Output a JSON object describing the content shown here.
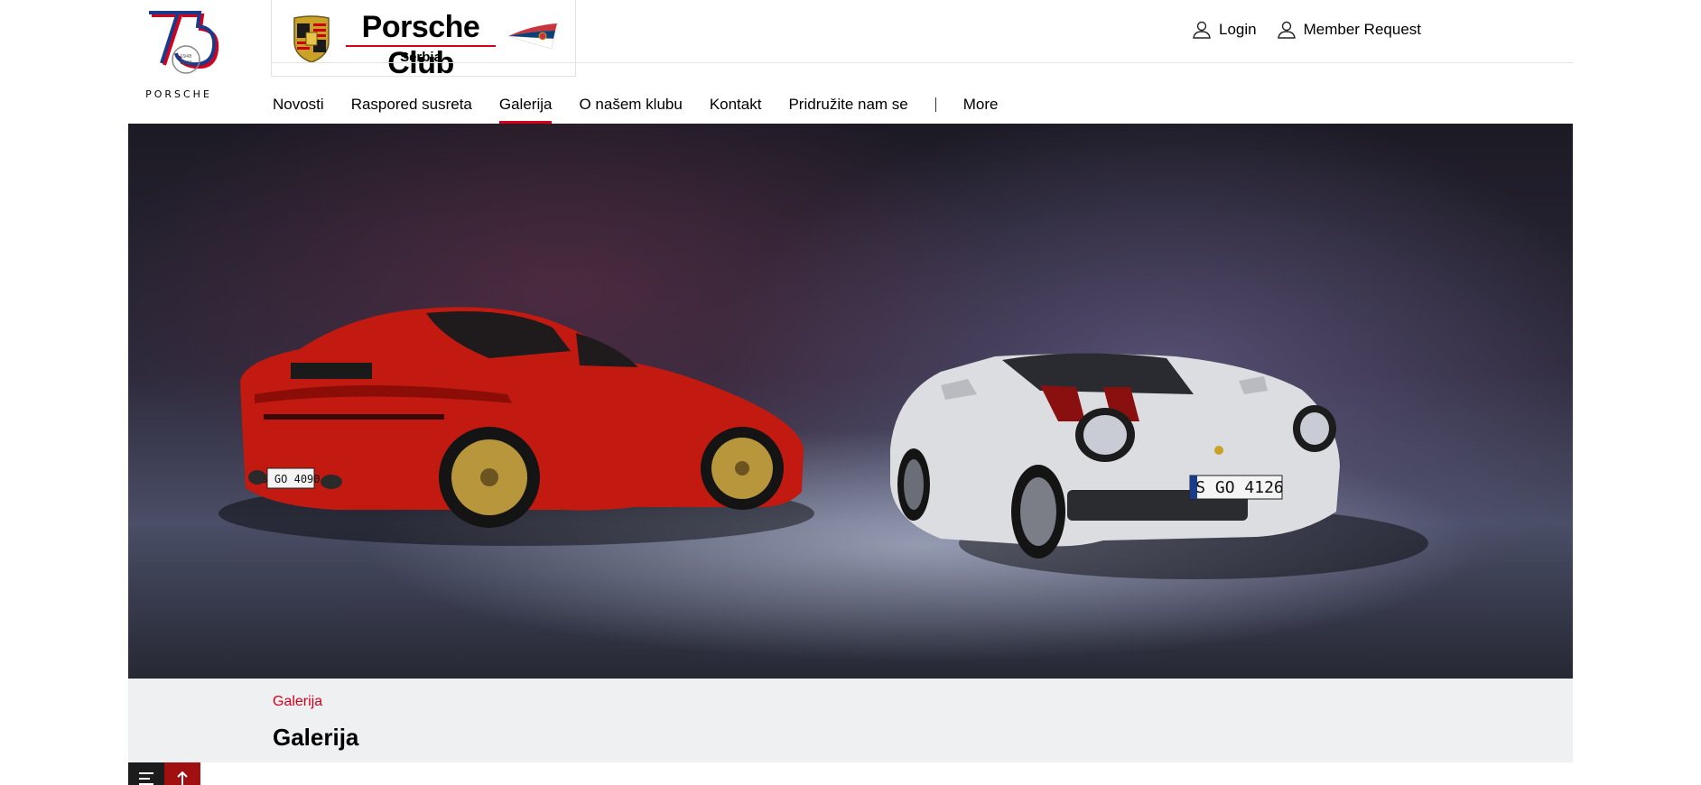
{
  "header": {
    "club_name": "Porsche Club",
    "club_region": "Serbia",
    "logo_icon": "porsche-75-logo",
    "crest_icon": "porsche-crest-icon",
    "flag_icon": "serbia-flag-icon",
    "actions": [
      {
        "label": "Login",
        "icon": "user-icon"
      },
      {
        "label": "Member Request",
        "icon": "user-icon"
      }
    ]
  },
  "nav": {
    "items": [
      {
        "label": "Novosti"
      },
      {
        "label": "Raspored susreta"
      },
      {
        "label": "Galerija",
        "active": true
      },
      {
        "label": "O našem klubu"
      },
      {
        "label": "Kontakt"
      },
      {
        "label": "Pridružite nam se"
      }
    ],
    "more_label": "More"
  },
  "hero": {
    "plate_left": "S GO 4090",
    "plate_right": "S GO 4126"
  },
  "page": {
    "breadcrumb": "Galerija",
    "title": "Galerija"
  },
  "colors": {
    "accent": "#d5001c",
    "band": "#eff0f1"
  }
}
